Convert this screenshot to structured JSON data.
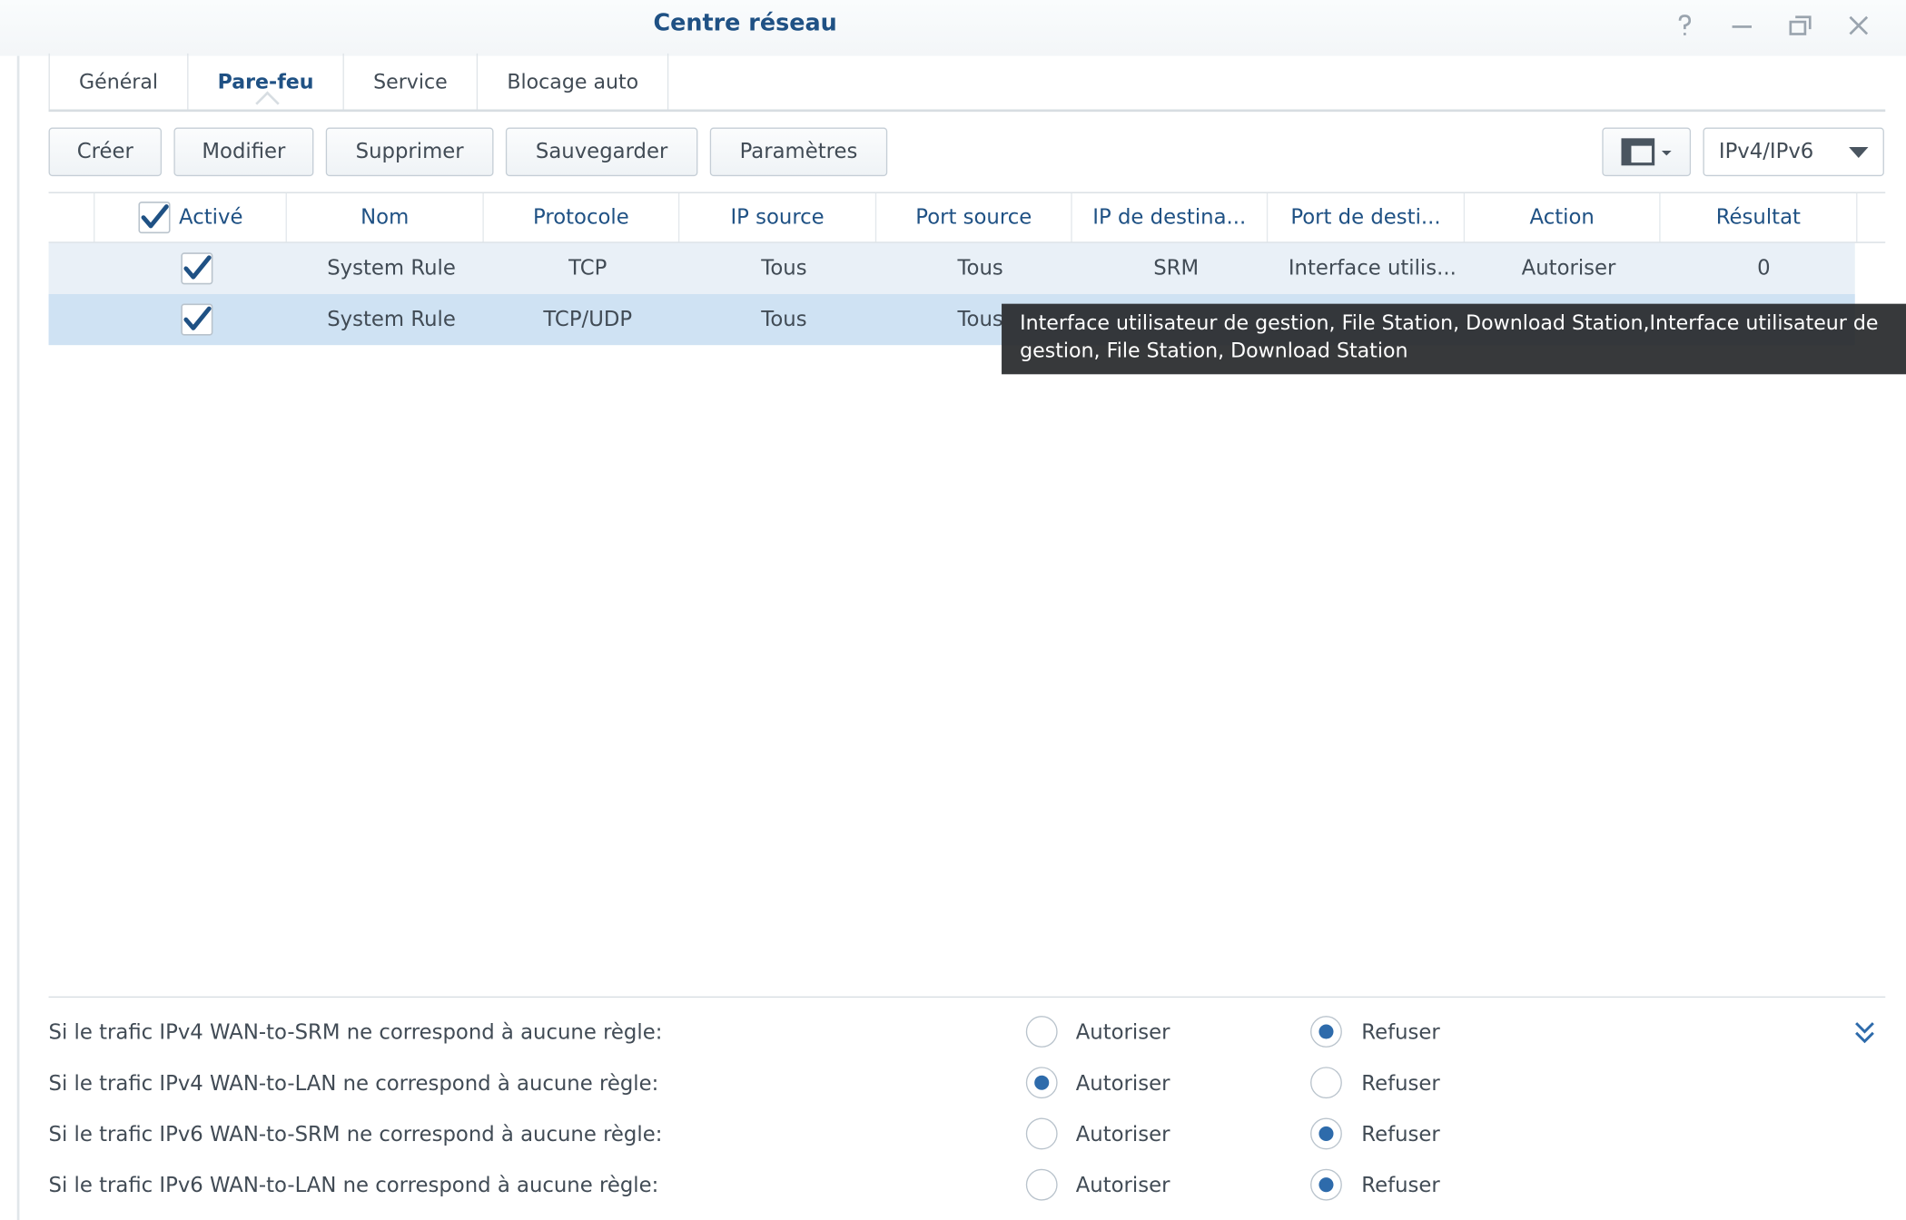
{
  "window": {
    "title": "Centre réseau"
  },
  "tabs": [
    {
      "label": "Général",
      "active": false
    },
    {
      "label": "Pare-feu",
      "active": true
    },
    {
      "label": "Service",
      "active": false
    },
    {
      "label": "Blocage auto",
      "active": false
    }
  ],
  "toolbar": {
    "create_label": "Créer",
    "edit_label": "Modifier",
    "delete_label": "Supprimer",
    "save_label": "Sauvegarder",
    "settings_label": "Paramètres",
    "ip_version_value": "IPv4/IPv6"
  },
  "grid": {
    "columns": [
      "Activé",
      "Nom",
      "Protocole",
      "IP source",
      "Port source",
      "IP de destina...",
      "Port de desti...",
      "Action",
      "Résultat"
    ],
    "rows": [
      {
        "enabled": true,
        "name": "System Rule",
        "protocol": "TCP",
        "src_ip": "Tous",
        "src_port": "Tous",
        "dst_ip": "SRM",
        "dst_port": "Interface utilis...",
        "action": "Autoriser",
        "result": "0"
      },
      {
        "enabled": true,
        "name": "System Rule",
        "protocol": "TCP/UDP",
        "src_ip": "Tous",
        "src_port": "Tous",
        "dst_ip": "",
        "dst_port": "",
        "action": "",
        "result": ""
      }
    ]
  },
  "tooltip": {
    "text": "Interface utilisateur de gestion, File Station, Download Station,Interface utilisateur de gestion, File Station, Download Station"
  },
  "policies": [
    {
      "label": "Si le trafic IPv4 WAN-to-SRM ne correspond à aucune règle:",
      "allow_label": "Autoriser",
      "deny_label": "Refuser",
      "selected": "deny"
    },
    {
      "label": "Si le trafic IPv4 WAN-to-LAN ne correspond à aucune règle:",
      "allow_label": "Autoriser",
      "deny_label": "Refuser",
      "selected": "allow"
    },
    {
      "label": "Si le trafic IPv6 WAN-to-SRM ne correspond à aucune règle:",
      "allow_label": "Autoriser",
      "deny_label": "Refuser",
      "selected": "deny"
    },
    {
      "label": "Si le trafic IPv6 WAN-to-LAN ne correspond à aucune règle:",
      "allow_label": "Autoriser",
      "deny_label": "Refuser",
      "selected": "deny"
    }
  ],
  "icons": {
    "help": "help-icon",
    "minimize": "minimize-icon",
    "restore": "restore-icon",
    "close": "close-icon",
    "layout": "column-layout-icon",
    "dropdown": "chevron-down-icon",
    "check": "checkmark-icon",
    "collapse": "double-chevron-down-icon"
  },
  "colors": {
    "title": "#1f5184",
    "header_text": "#1f5184",
    "row_selected": "#cfe2f3",
    "row_alt": "#e9f0f7",
    "radio_on": "#2e6bab",
    "tooltip_bg": "#282a2c"
  }
}
